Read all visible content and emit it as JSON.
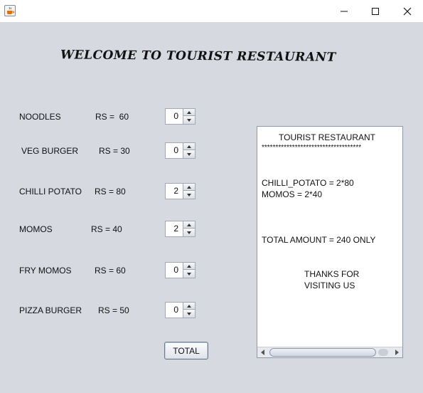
{
  "window": {
    "icon": "java-cup-icon",
    "controls": [
      "minimize-icon",
      "maximize-icon",
      "close-icon"
    ]
  },
  "heading": "WELCOME TO TOURIST RESTAURANT",
  "menu": [
    {
      "name": "NOODLES",
      "price": "RS =  60",
      "qty": "0"
    },
    {
      "name": "VEG BURGER",
      "price": "RS = 30",
      "qty": "0"
    },
    {
      "name": "CHILLI POTATO",
      "price": "RS = 80",
      "qty": "2"
    },
    {
      "name": "MOMOS",
      "price": "RS = 40",
      "qty": "2"
    },
    {
      "name": "FRY MOMOS",
      "price": "RS = 60",
      "qty": "0"
    },
    {
      "name": "PIZZA BURGER",
      "price": "RS = 50",
      "qty": "0"
    }
  ],
  "total_button": "TOTAL",
  "receipt": {
    "title": "TOURIST RESTAURANT",
    "divider": "************************************",
    "lines": [
      "CHILLI_POTATO = 2*80",
      "MOMOS = 2*40"
    ],
    "total": "TOTAL AMOUNT = 240 ONLY",
    "thanks": [
      "THANKS FOR",
      "VISITING US"
    ]
  }
}
